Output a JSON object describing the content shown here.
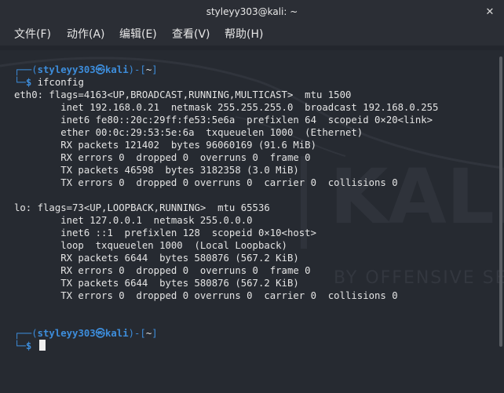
{
  "window": {
    "title": "styleyy303@kali: ~"
  },
  "menu": [
    {
      "label": "文件(F)"
    },
    {
      "label": "动作(A)"
    },
    {
      "label": "编辑(E)"
    },
    {
      "label": "查看(V)"
    },
    {
      "label": "帮助(H)"
    }
  ],
  "watermark": {
    "brand": "KALI",
    "tagline": "BY OFFENSIVE SECURITY"
  },
  "prompt": {
    "corner_top": "┌──(",
    "user": "styleyy303",
    "skull": "㉿",
    "host": "kali",
    "path_open": ")-[",
    "path": "~",
    "path_close": "]",
    "corner_bottom": "└─",
    "symbol": "$"
  },
  "command": "ifconfig",
  "output": [
    "eth0: flags=4163<UP,BROADCAST,RUNNING,MULTICAST>  mtu 1500",
    "        inet 192.168.0.21  netmask 255.255.255.0  broadcast 192.168.0.255",
    "        inet6 fe80::20c:29ff:fe53:5e6a  prefixlen 64  scopeid 0×20<link>",
    "        ether 00:0c:29:53:5e:6a  txqueuelen 1000  (Ethernet)",
    "        RX packets 121402  bytes 96060169 (91.6 MiB)",
    "        RX errors 0  dropped 0  overruns 0  frame 0",
    "        TX packets 46598  bytes 3182358 (3.0 MiB)",
    "        TX errors 0  dropped 0 overruns 0  carrier 0  collisions 0",
    "",
    "lo: flags=73<UP,LOOPBACK,RUNNING>  mtu 65536",
    "        inet 127.0.0.1  netmask 255.0.0.0",
    "        inet6 ::1  prefixlen 128  scopeid 0×10<host>",
    "        loop  txqueuelen 1000  (Local Loopback)",
    "        RX packets 6644  bytes 580876 (567.2 KiB)",
    "        RX errors 0  dropped 0  overruns 0  frame 0",
    "        TX packets 6644  bytes 580876 (567.2 KiB)",
    "        TX errors 0  dropped 0 overruns 0  carrier 0  collisions 0"
  ],
  "icons": {
    "close": "close-icon"
  },
  "colors": {
    "prompt_blue": "#3d8ddb",
    "background": "#262a31",
    "text": "#e4e4e4"
  }
}
